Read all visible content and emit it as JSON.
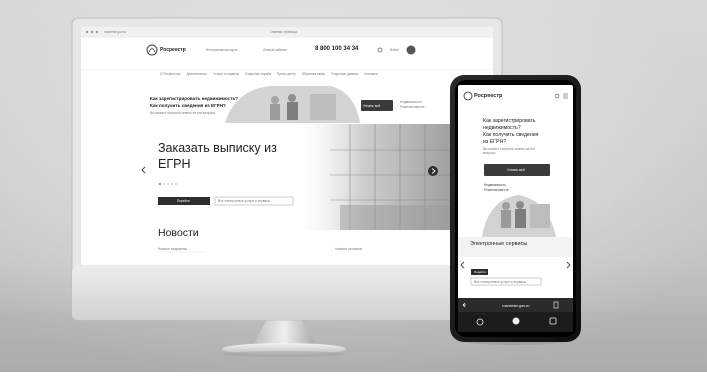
{
  "browser": {
    "url": "rosreestr.gov.ru",
    "tab_title": "Главная страница"
  },
  "site": {
    "logo_text": "Росреестр",
    "header_links": [
      "Интерактивная карта",
      "Личный кабинет"
    ],
    "phone": "8 800 100 34 34",
    "login_label": "Войти",
    "nav_items": [
      "О Росреестре",
      "Деятельность",
      "Услуги и сервисы",
      "Открытая служба",
      "Пресс-центр",
      "Обратная связь",
      "Открытые данные",
      "Контакты"
    ],
    "promo": {
      "question_line1": "Как зарегистрировать недвижимость?",
      "question_line2": "Как получить сведения из ЕГРН?",
      "sub": "Вы можете получить ответы на эти вопросы",
      "button": "Узнать всё",
      "side_text1": "Недвижимость",
      "side_text2": "Решения вместе"
    },
    "hero": {
      "title_line1": "Заказать выписку из",
      "title_line2": "ЕГРН",
      "cta": "Перейти",
      "all_services": "Все электронные услуги и сервисы"
    },
    "news": {
      "heading": "Новости",
      "left_link": "Новости ведомства",
      "right_link": "Новости регионов"
    }
  },
  "phone_screen": {
    "logo_text": "Росреестр",
    "promo_line1": "Как зарегистрировать",
    "promo_line2": "недвижимость?",
    "promo_line3": "Как получить сведения",
    "promo_line4": "из ЕГРН?",
    "promo_sub": "Вы можете получить ответы на эти вопросы",
    "button": "Узнать всё",
    "side1": "Недвижимость",
    "side2": "Решения вместе",
    "services_heading": "Электронные сервисы",
    "cta": "Перейти",
    "all_services": "Все электронные услуги и сервисы",
    "url": "rosreestr.gov.ru"
  },
  "colors": {
    "wall": "#c8c8c8",
    "monitor_frame": "#e9e9e9",
    "screen_bg": "#ffffff",
    "phone_body": "#1a1a1a",
    "accent": "#3a3a3a"
  }
}
